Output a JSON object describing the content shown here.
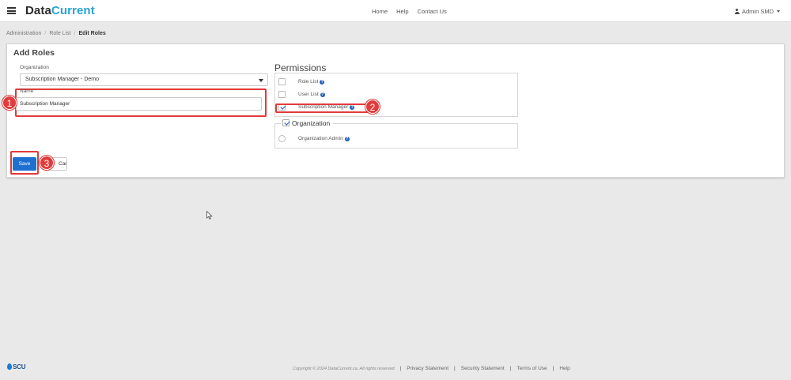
{
  "app": {
    "brand_part1": "Data",
    "brand_part2": "Current",
    "nav": {
      "home": "Home",
      "help": "Help",
      "contact": "Contact Us"
    },
    "user": "Admin SMD"
  },
  "breadcrumb": {
    "items": [
      "Administration",
      "Role List",
      "Edit Roles"
    ]
  },
  "form": {
    "title": "Add Roles",
    "organization_label": "Organization",
    "organization_value": "Subscription Manager - Demo",
    "name_label": "Name",
    "name_value": "Subscription Manager",
    "save_label": "Save",
    "cancel_label": "Cancel"
  },
  "permissions": {
    "title": "Permissions",
    "items": [
      {
        "label": "Role List",
        "checked": false
      },
      {
        "label": "User List",
        "checked": false
      },
      {
        "label": "Subscription Manager",
        "checked": true
      }
    ],
    "organization": {
      "legend": "Organization",
      "checked": true,
      "items": [
        {
          "label": "Organization Admin",
          "selected": false
        }
      ]
    }
  },
  "annotations": [
    "1",
    "2",
    "3"
  ],
  "footer": {
    "logo": "SCU",
    "copyright": "Copyright © 2024 DataCurrent.ca, All rights reserved",
    "links": [
      "Privacy Statement",
      "Security Statement",
      "Terms of Use",
      "Help"
    ]
  },
  "colors": {
    "accent": "#29a3d9",
    "primary_button": "#1f6fd1",
    "annotation": "#e23b3b"
  }
}
